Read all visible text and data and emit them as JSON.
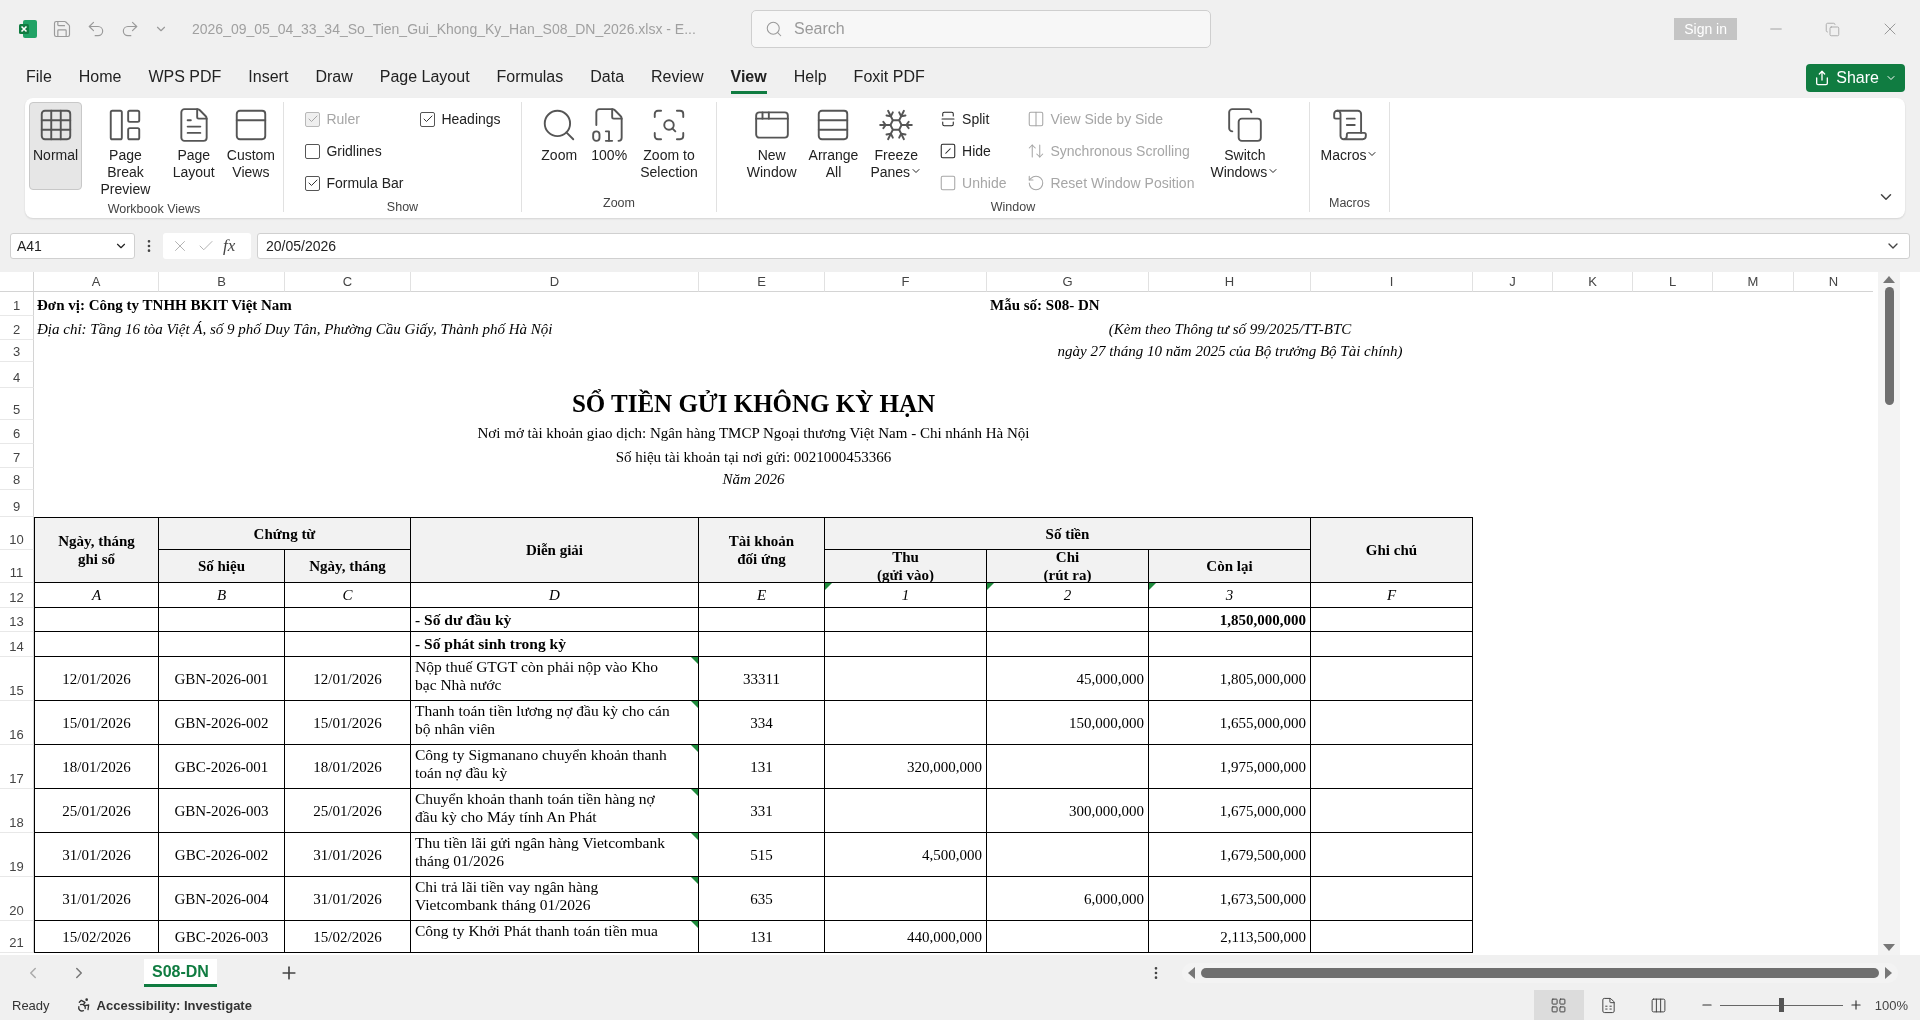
{
  "title_bar": {
    "file_name": "2026_09_05_04_33_34_So_Tien_Gui_Khong_Ky_Han_S08_DN_2026.xlsx  -  E...",
    "search_placeholder": "Search",
    "sign_in": "Sign in"
  },
  "menu_tabs": [
    {
      "label": "File",
      "selected": false
    },
    {
      "label": "Home",
      "selected": false
    },
    {
      "label": "WPS PDF",
      "selected": false
    },
    {
      "label": "Insert",
      "selected": false
    },
    {
      "label": "Draw",
      "selected": false
    },
    {
      "label": "Page Layout",
      "selected": false
    },
    {
      "label": "Formulas",
      "selected": false
    },
    {
      "label": "Data",
      "selected": false
    },
    {
      "label": "Review",
      "selected": false
    },
    {
      "label": "View",
      "selected": true
    },
    {
      "label": "Help",
      "selected": false
    },
    {
      "label": "Foxit PDF",
      "selected": false
    }
  ],
  "share_button": "Share",
  "ribbon": {
    "groups": [
      {
        "label": "Workbook Views",
        "items": [
          {
            "kind": "large",
            "label": "Normal",
            "selected": true
          },
          {
            "kind": "large",
            "label": "Page Break\nPreview",
            "selected": false
          },
          {
            "kind": "large",
            "label": "Page\nLayout",
            "selected": false
          },
          {
            "kind": "large",
            "label": "Custom\nViews",
            "selected": false
          }
        ]
      },
      {
        "label": "Show",
        "items": [
          {
            "kind": "check",
            "label": "Ruler",
            "checked": true,
            "disabled": true
          },
          {
            "kind": "check",
            "label": "Gridlines",
            "checked": false,
            "disabled": false
          },
          {
            "kind": "check",
            "label": "Formula Bar",
            "checked": true,
            "disabled": false
          },
          {
            "kind": "check",
            "label": "Headings",
            "checked": true,
            "disabled": false
          }
        ]
      },
      {
        "label": "Zoom",
        "items": [
          {
            "kind": "large",
            "label": "Zoom"
          },
          {
            "kind": "large",
            "label": "100%"
          },
          {
            "kind": "large",
            "label": "Zoom to\nSelection"
          }
        ]
      },
      {
        "label": "Window",
        "items": [
          {
            "kind": "large",
            "label": "New\nWindow"
          },
          {
            "kind": "large",
            "label": "Arrange\nAll"
          },
          {
            "kind": "large",
            "label": "Freeze\nPanes",
            "dropdown": true
          },
          {
            "kind": "small",
            "label": "Split",
            "disabled": false
          },
          {
            "kind": "small",
            "label": "Hide",
            "disabled": false
          },
          {
            "kind": "small",
            "label": "Unhide",
            "disabled": true
          },
          {
            "kind": "small",
            "label": "View Side by Side",
            "disabled": true
          },
          {
            "kind": "small",
            "label": "Synchronous Scrolling",
            "disabled": true
          },
          {
            "kind": "small",
            "label": "Reset Window Position",
            "disabled": true
          },
          {
            "kind": "large",
            "label": "Switch\nWindows",
            "dropdown": true
          }
        ]
      },
      {
        "label": "Macros",
        "items": [
          {
            "kind": "large",
            "label": "Macros",
            "dropdown": true
          }
        ]
      }
    ]
  },
  "formula_bar": {
    "name_box": "A41",
    "function_label": "fx",
    "formula": "20/05/2026"
  },
  "sheet": {
    "columns": [
      "A",
      "B",
      "C",
      "D",
      "E",
      "F",
      "G",
      "H",
      "I",
      "J",
      "K",
      "L",
      "M",
      "N"
    ],
    "row_numbers": [
      "1",
      "2",
      "3",
      "4",
      "5",
      "6",
      "7",
      "8",
      "9",
      "10",
      "11",
      "12",
      "13",
      "14",
      "15",
      "16",
      "17",
      "18",
      "19",
      "20",
      "21"
    ],
    "unit": "Đơn vị: Công ty TNHH BKIT Việt Nam",
    "form_no": "Mẫu số: S08- DN",
    "address": "Địa chỉ: Tầng 16 tòa Việt Á, số 9 phố Duy Tân, Phường Cầu Giấy, Thành phố Hà Nội",
    "circular_1": "(Kèm theo Thông tư số 99/2025/TT-BTC",
    "circular_2": "ngày 27 tháng 10 năm 2025 của Bộ trưởng Bộ Tài chính)",
    "title": "SỔ TIỀN GỬI KHÔNG KỲ HẠN",
    "bank": "Nơi mở tài khoản giao dịch: Ngân hàng TMCP Ngoại thương Việt Nam - Chi nhánh Hà Nội",
    "account": "Số hiệu tài khoản tại nơi gửi: 0021000453366",
    "year": "Năm 2026",
    "table": {
      "headers": {
        "date_recorded": "Ngày, tháng\nghi sổ",
        "voucher": "Chứng từ",
        "voucher_no": "Số hiệu",
        "voucher_date": "Ngày, tháng",
        "description": "Diễn giải",
        "contra_account": "Tài khoản\nđối ứng",
        "amount": "Số tiền",
        "receipts": "Thu\n(gửi vào)",
        "payments": "Chi\n(rút ra)",
        "balance": "Còn lại",
        "notes": "Ghi chú"
      },
      "codes": [
        {
          "text": "A",
          "flagged": false
        },
        {
          "text": "B",
          "flagged": false
        },
        {
          "text": "C",
          "flagged": false
        },
        {
          "text": "D",
          "flagged": false
        },
        {
          "text": "E",
          "flagged": false
        },
        {
          "text": "1",
          "flagged": true
        },
        {
          "text": "2",
          "flagged": true
        },
        {
          "text": "3",
          "flagged": true
        },
        {
          "text": "F",
          "flagged": false
        }
      ],
      "rows": [
        {
          "kind": "summary",
          "description": "- Số dư đầu kỳ",
          "balance": "1,850,000,000"
        },
        {
          "kind": "summary",
          "description": "- Số phát sinh trong kỳ"
        },
        {
          "kind": "entry",
          "date": "12/01/2026",
          "voucher_no": "GBN-2026-001",
          "voucher_date": "12/01/2026",
          "description": "Nộp thuế GTGT còn phải nộp vào Kho bạc Nhà nước",
          "flagged": true,
          "account": "33311",
          "payment": "45,000,000",
          "balance": "1,805,000,000"
        },
        {
          "kind": "entry",
          "date": "15/01/2026",
          "voucher_no": "GBN-2026-002",
          "voucher_date": "15/01/2026",
          "description": "Thanh toán tiền lương nợ đầu kỳ cho cán bộ nhân viên",
          "flagged": true,
          "account": "334",
          "payment": "150,000,000",
          "balance": "1,655,000,000"
        },
        {
          "kind": "entry",
          "date": "18/01/2026",
          "voucher_no": "GBC-2026-001",
          "voucher_date": "18/01/2026",
          "description": "Công ty Sigmanano chuyển khoản thanh toán nợ đầu kỳ",
          "flagged": true,
          "account": "131",
          "receipt": "320,000,000",
          "balance": "1,975,000,000"
        },
        {
          "kind": "entry",
          "date": "25/01/2026",
          "voucher_no": "GBN-2026-003",
          "voucher_date": "25/01/2026",
          "description": "Chuyển khoản thanh toán tiền hàng nợ đầu kỳ cho Máy tính An Phát",
          "flagged": true,
          "account": "331",
          "payment": "300,000,000",
          "balance": "1,675,000,000"
        },
        {
          "kind": "entry",
          "date": "31/01/2026",
          "voucher_no": "GBC-2026-002",
          "voucher_date": "31/01/2026",
          "description": "Thu tiền lãi gửi ngân hàng Vietcombank tháng 01/2026",
          "flagged": true,
          "account": "515",
          "receipt": "4,500,000",
          "balance": "1,679,500,000"
        },
        {
          "kind": "entry",
          "date": "31/01/2026",
          "voucher_no": "GBN-2026-004",
          "voucher_date": "31/01/2026",
          "description": "Chi trả lãi tiền vay ngân hàng Vietcombank tháng 01/2026",
          "flagged": true,
          "account": "635",
          "payment": "6,000,000",
          "balance": "1,673,500,000"
        },
        {
          "kind": "entry",
          "date": "15/02/2026",
          "voucher_no": "GBC-2026-003",
          "voucher_date": "15/02/2026",
          "description": "Công ty Khởi Phát thanh toán tiền mua",
          "flagged": true,
          "account": "131",
          "receipt": "440,000,000",
          "balance": "2,113,500,000"
        }
      ]
    }
  },
  "sheet_tabs": [
    {
      "label": "S08-DN",
      "selected": true
    }
  ],
  "status_bar": {
    "ready": "Ready",
    "accessibility": "Accessibility: Investigate",
    "views": [
      {
        "selected": true
      },
      {
        "selected": false
      },
      {
        "selected": false
      }
    ],
    "zoom_slider": {
      "level": 0.5
    },
    "zoom": "100%"
  }
}
